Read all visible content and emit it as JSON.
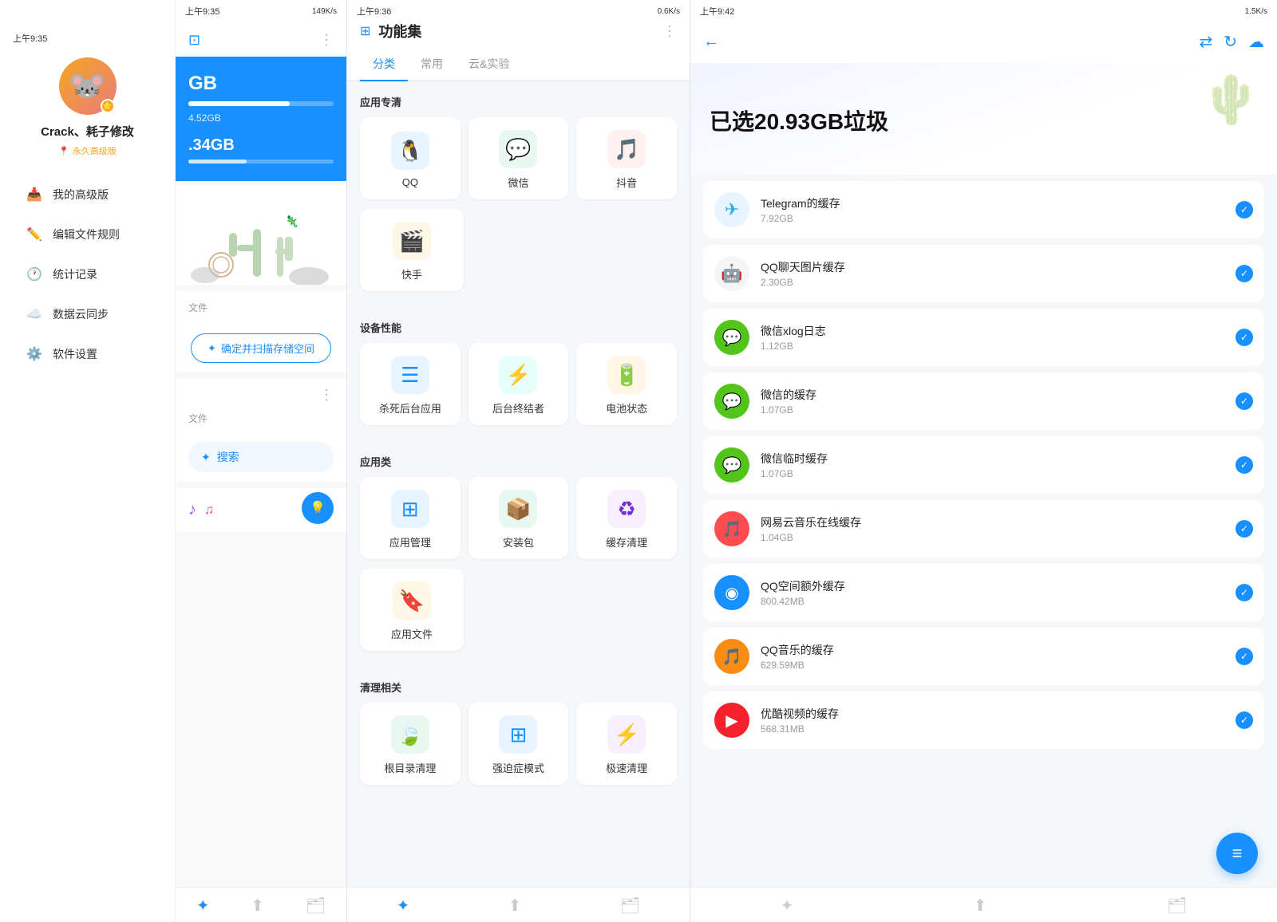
{
  "panel1": {
    "status": "上午9:35",
    "username": "Crack、耗子修改",
    "vip": "永久高级版",
    "avatar_emoji": "🐭",
    "nav": [
      {
        "id": "premium",
        "icon": "📥",
        "label": "我的高级版"
      },
      {
        "id": "edit-rules",
        "icon": "✏️",
        "label": "编辑文件规则"
      },
      {
        "id": "stats",
        "icon": "🕐",
        "label": "统计记录"
      },
      {
        "id": "cloud-sync",
        "icon": "☁️",
        "label": "数据云同步"
      },
      {
        "id": "settings",
        "icon": "⚙️",
        "label": "软件设置"
      }
    ],
    "bottom_nav": [
      {
        "id": "fan",
        "icon": "✦",
        "active": true
      },
      {
        "id": "star",
        "icon": "⬆"
      },
      {
        "id": "folder",
        "icon": "🗂"
      }
    ]
  },
  "panel2": {
    "status": "上午9:35",
    "status_right": "149K/s",
    "storage1": {
      "size": "GB",
      "fill_percent": 70,
      "sub": "4.52GB"
    },
    "storage2": {
      "size": ".34GB",
      "fill_percent": 40
    },
    "file_label1": "文件",
    "confirm_btn": "确定并扫描存储空间",
    "file_label2": "文件",
    "search_label": "搜索",
    "bottom_nav": [
      {
        "id": "fan",
        "icon": "✦",
        "active": true
      },
      {
        "id": "star",
        "icon": "⬆"
      },
      {
        "id": "folder",
        "icon": "🗂"
      }
    ]
  },
  "panel3": {
    "status": "上午9:36",
    "status_right": "0.6K/s",
    "title": "功能集",
    "tabs": [
      {
        "id": "category",
        "label": "分类",
        "active": true
      },
      {
        "id": "common",
        "label": "常用",
        "active": false
      },
      {
        "id": "cloud",
        "label": "云&实验",
        "active": false
      }
    ],
    "sections": [
      {
        "title": "应用专清",
        "items": [
          {
            "id": "qq",
            "icon": "🐧",
            "icon_bg": "blue",
            "label": "QQ"
          },
          {
            "id": "wechat",
            "icon": "💬",
            "icon_bg": "green",
            "label": "微信"
          },
          {
            "id": "douyin",
            "icon": "🎵",
            "icon_bg": "red",
            "label": "抖音"
          },
          {
            "id": "kuaishou",
            "icon": "🎬",
            "icon_bg": "orange",
            "label": "快手"
          }
        ]
      },
      {
        "title": "设备性能",
        "items": [
          {
            "id": "kill-bg",
            "icon": "☰",
            "icon_bg": "blue",
            "label": "杀死后台应用"
          },
          {
            "id": "bg-killer",
            "icon": "⚡",
            "icon_bg": "teal",
            "label": "后台终结者"
          },
          {
            "id": "battery",
            "icon": "🔋",
            "icon_bg": "orange",
            "label": "电池状态"
          }
        ]
      },
      {
        "title": "应用类",
        "items": [
          {
            "id": "app-mgr",
            "icon": "⊞",
            "icon_bg": "blue",
            "label": "应用管理"
          },
          {
            "id": "apk",
            "icon": "📦",
            "icon_bg": "green",
            "label": "安装包"
          },
          {
            "id": "cache-clean",
            "icon": "♻",
            "icon_bg": "purple",
            "label": "缓存清理"
          },
          {
            "id": "app-file",
            "icon": "🔖",
            "icon_bg": "orange",
            "label": "应用文件"
          }
        ]
      },
      {
        "title": "清理相关",
        "items": [
          {
            "id": "dir-clean",
            "icon": "🍃",
            "icon_bg": "green",
            "label": "根目录清理"
          },
          {
            "id": "ocd-mode",
            "icon": "⊞",
            "icon_bg": "blue",
            "label": "强迫症模式"
          },
          {
            "id": "fast-clean",
            "icon": "⚡",
            "icon_bg": "purple",
            "label": "极速清理"
          }
        ]
      }
    ],
    "bottom_nav": [
      {
        "id": "fan",
        "icon": "✦",
        "active": true
      },
      {
        "id": "star",
        "icon": "⬆"
      },
      {
        "id": "folder",
        "icon": "🗂"
      }
    ]
  },
  "panel4": {
    "status": "上午9:42",
    "status_right": "1.5K/s",
    "hero_title": "已选20.93GB垃圾",
    "junk_items": [
      {
        "id": "telegram",
        "icon": "✈",
        "icon_color": "#2AABEE",
        "icon_bg": "#e8f4ff",
        "name": "Telegram的缓存",
        "size": "7.92GB",
        "checked": true
      },
      {
        "id": "qq-chat",
        "icon": "🐧",
        "icon_color": "#111",
        "icon_bg": "#f5f5f5",
        "name": "QQ聊天图片缓存",
        "size": "2.30GB",
        "checked": true
      },
      {
        "id": "wechat-xlog",
        "icon": "💬",
        "icon_color": "#fff",
        "icon_bg": "#52c41a",
        "name": "微信xlog日志",
        "size": "1.12GB",
        "checked": true
      },
      {
        "id": "wechat-cache",
        "icon": "💬",
        "icon_color": "#fff",
        "icon_bg": "#52c41a",
        "name": "微信的缓存",
        "size": "1.07GB",
        "checked": true
      },
      {
        "id": "wechat-temp",
        "icon": "💬",
        "icon_color": "#fff",
        "icon_bg": "#52c41a",
        "name": "微信临时缓存",
        "size": "1.07GB",
        "checked": true
      },
      {
        "id": "netease",
        "icon": "🎵",
        "icon_color": "#fff",
        "icon_bg": "#f5222d",
        "name": "网易云音乐在线缓存",
        "size": "1.04GB",
        "checked": true
      },
      {
        "id": "qq-zone",
        "icon": "◉",
        "icon_color": "#fff",
        "icon_bg": "#1890ff",
        "name": "QQ空间额外缓存",
        "size": "800.42MB",
        "checked": true
      },
      {
        "id": "qq-music",
        "icon": "🎵",
        "icon_color": "#fff",
        "icon_bg": "#fa8c16",
        "name": "QQ音乐的缓存",
        "size": "629.59MB",
        "checked": true
      },
      {
        "id": "youku",
        "icon": "▶",
        "icon_color": "#fff",
        "icon_bg": "#f5222d",
        "name": "优酷视频的缓存",
        "size": "568.31MB",
        "checked": true
      }
    ],
    "fab_icon": "≡",
    "bottom_nav": [
      {
        "id": "fan",
        "icon": "✦"
      },
      {
        "id": "star",
        "icon": "⬆"
      },
      {
        "id": "folder",
        "icon": "🗂"
      }
    ]
  }
}
